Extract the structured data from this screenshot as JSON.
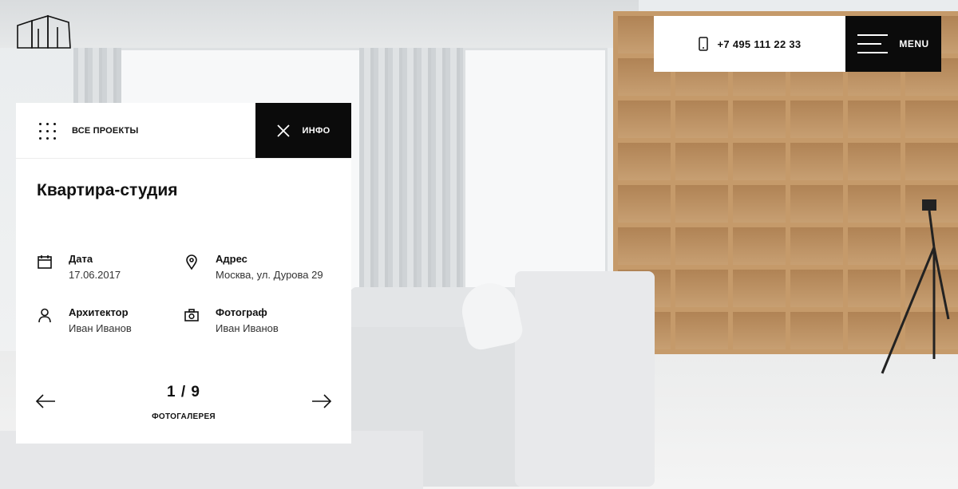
{
  "header": {
    "phone": "+7 495 111 22 33",
    "menu_label": "MENU"
  },
  "card": {
    "all_projects_label": "ВСЕ ПРОЕКТЫ",
    "info_label": "ИНФО",
    "title": "Квартира-студия",
    "fields": [
      {
        "label": "Дата",
        "value": "17.06.2017",
        "icon": "calendar-icon"
      },
      {
        "label": "Адрес",
        "value": "Москва, ул. Дурова 29",
        "icon": "location-pin-icon"
      },
      {
        "label": "Архитектор",
        "value": "Иван Иванов",
        "icon": "user-icon"
      },
      {
        "label": "Фотограф",
        "value": "Иван Иванов",
        "icon": "camera-icon"
      }
    ],
    "gallery": {
      "counter": "1 / 9",
      "label": "ФОТОГАЛЕРЕЯ",
      "current": 1,
      "total": 9
    }
  },
  "colors": {
    "dark": "#0b0b0b",
    "panel": "#ffffff",
    "shelf_wood": "#c59a6a"
  }
}
